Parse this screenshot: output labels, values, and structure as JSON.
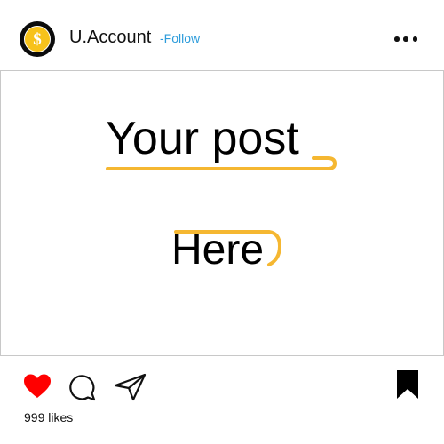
{
  "header": {
    "username": "U.Account",
    "follow_label": "-Follow",
    "avatar_symbol": "$",
    "more_icon": "more-horizontal-icon"
  },
  "post": {
    "line1": "Your post",
    "line2": "Here",
    "accent_color": "#f5b731"
  },
  "actions": {
    "like_icon": "heart-filled-icon",
    "comment_icon": "comment-bubble-icon",
    "share_icon": "paper-plane-icon",
    "save_icon": "bookmark-filled-icon",
    "like_color": "#ff0000"
  },
  "footer": {
    "likes_text": "999 likes"
  },
  "colors": {
    "follow": "#2d9cdb",
    "avatar_bg": "#0c0c0c",
    "avatar_coin": "#f7c21b"
  }
}
